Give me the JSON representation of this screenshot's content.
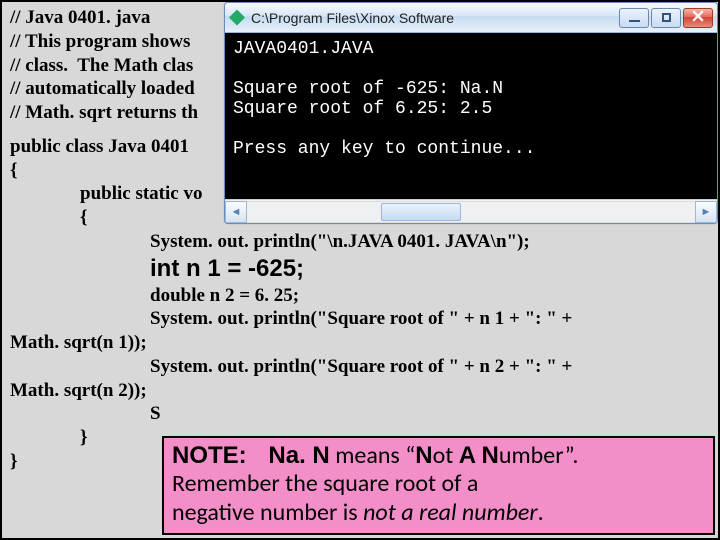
{
  "code": {
    "c1": "// Java 0401. java",
    "c2": "// This program shows",
    "c3": "// class.  The Math clas",
    "c4": "// automatically loaded",
    "c5": "// Math. sqrt returns th",
    "class_decl": "public class Java 0401",
    "brace_open": "{",
    "main_decl": "public static vo",
    "brace_open2": "{",
    "l1": "System. out. println(\"\\n.JAVA 0401. JAVA\\n\");",
    "int_decl": "int n 1 = -625;",
    "dbl_decl": "double n 2 = 6. 25;",
    "l2": "System. out. println(\"Square root of \" + n 1 + \": \" +",
    "l2b": "Math. sqrt(n 1));",
    "l3": "System. out. println(\"Square root of \" + n 2 + \": \" +",
    "l3b": "Math. sqrt(n 2));",
    "l4": "S",
    "brace_close2": "}",
    "brace_close": "}"
  },
  "console": {
    "title": "C:\\Program Files\\Xinox Software",
    "out1": "JAVA0401.JAVA",
    "out2": "Square root of -625: Na.N",
    "out3": "Square root of 6.25: 2.5",
    "out4": "Press any key to continue..."
  },
  "note": {
    "label": "NOTE:",
    "nan": "Na. N",
    "means": " means ",
    "quote_open": "“",
    "n": "N",
    "ot": "ot ",
    "a": "A",
    "space": " ",
    "n2": "N",
    "umber": "umber",
    "quote_close": "”.",
    "line2a": "Remember the square root of a",
    "line3a": "negative number is ",
    "ital": "not a real number",
    "dot": "."
  }
}
